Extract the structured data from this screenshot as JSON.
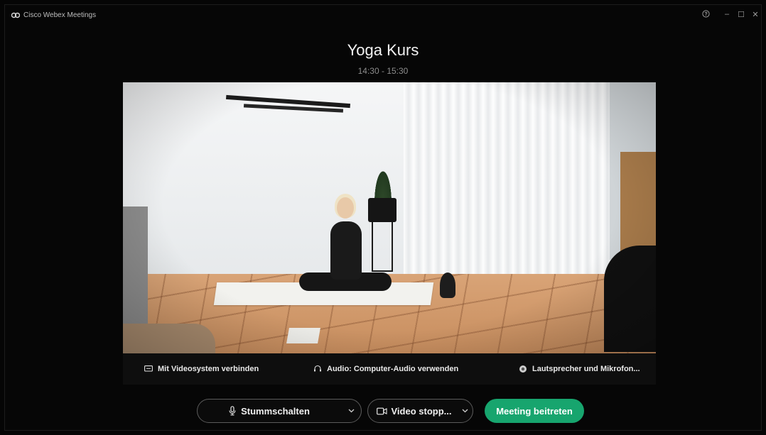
{
  "app": {
    "title": "Cisco Webex Meetings",
    "window_controls": {
      "help": "?",
      "minimize": "–",
      "maximize": "☐",
      "close": "✕"
    }
  },
  "meeting": {
    "title": "Yoga Kurs",
    "time": "14:30 - 15:30"
  },
  "options_bar": {
    "video_system_label": "Mit Videosystem verbinden",
    "audio_label": "Audio: Computer-Audio verwenden",
    "speaker_mic_label": "Lautsprecher und Mikrofon..."
  },
  "controls": {
    "mute_label": "Stummschalten",
    "video_label": "Video stopp...",
    "join_label": "Meeting beitreten"
  },
  "colors": {
    "join_button": "#17a56e",
    "background": "#050505"
  },
  "icons": [
    "webex-logo-icon",
    "help-icon",
    "minimize-icon",
    "maximize-icon",
    "close-icon",
    "video-system-icon",
    "headset-icon",
    "speaker-icon",
    "microphone-icon",
    "chevron-down-icon",
    "camera-icon"
  ]
}
